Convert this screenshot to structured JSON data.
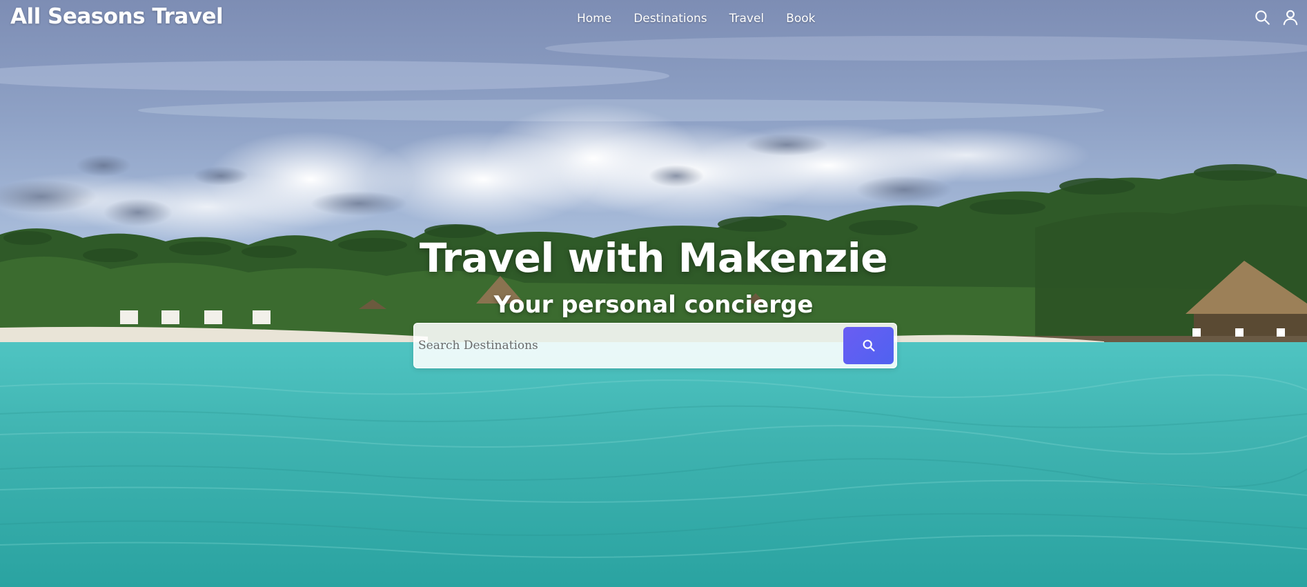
{
  "header": {
    "brand": "All Seasons Travel",
    "nav": [
      "Home",
      "Destinations",
      "Travel",
      "Book"
    ],
    "icons": [
      "search-icon",
      "user-icon"
    ]
  },
  "hero": {
    "title": "Travel with Makenzie",
    "subtitle": "Your personal concierge",
    "search": {
      "placeholder": "Search Destinations",
      "button_icon": "search-icon",
      "button_color": "#5b5ff2"
    }
  }
}
